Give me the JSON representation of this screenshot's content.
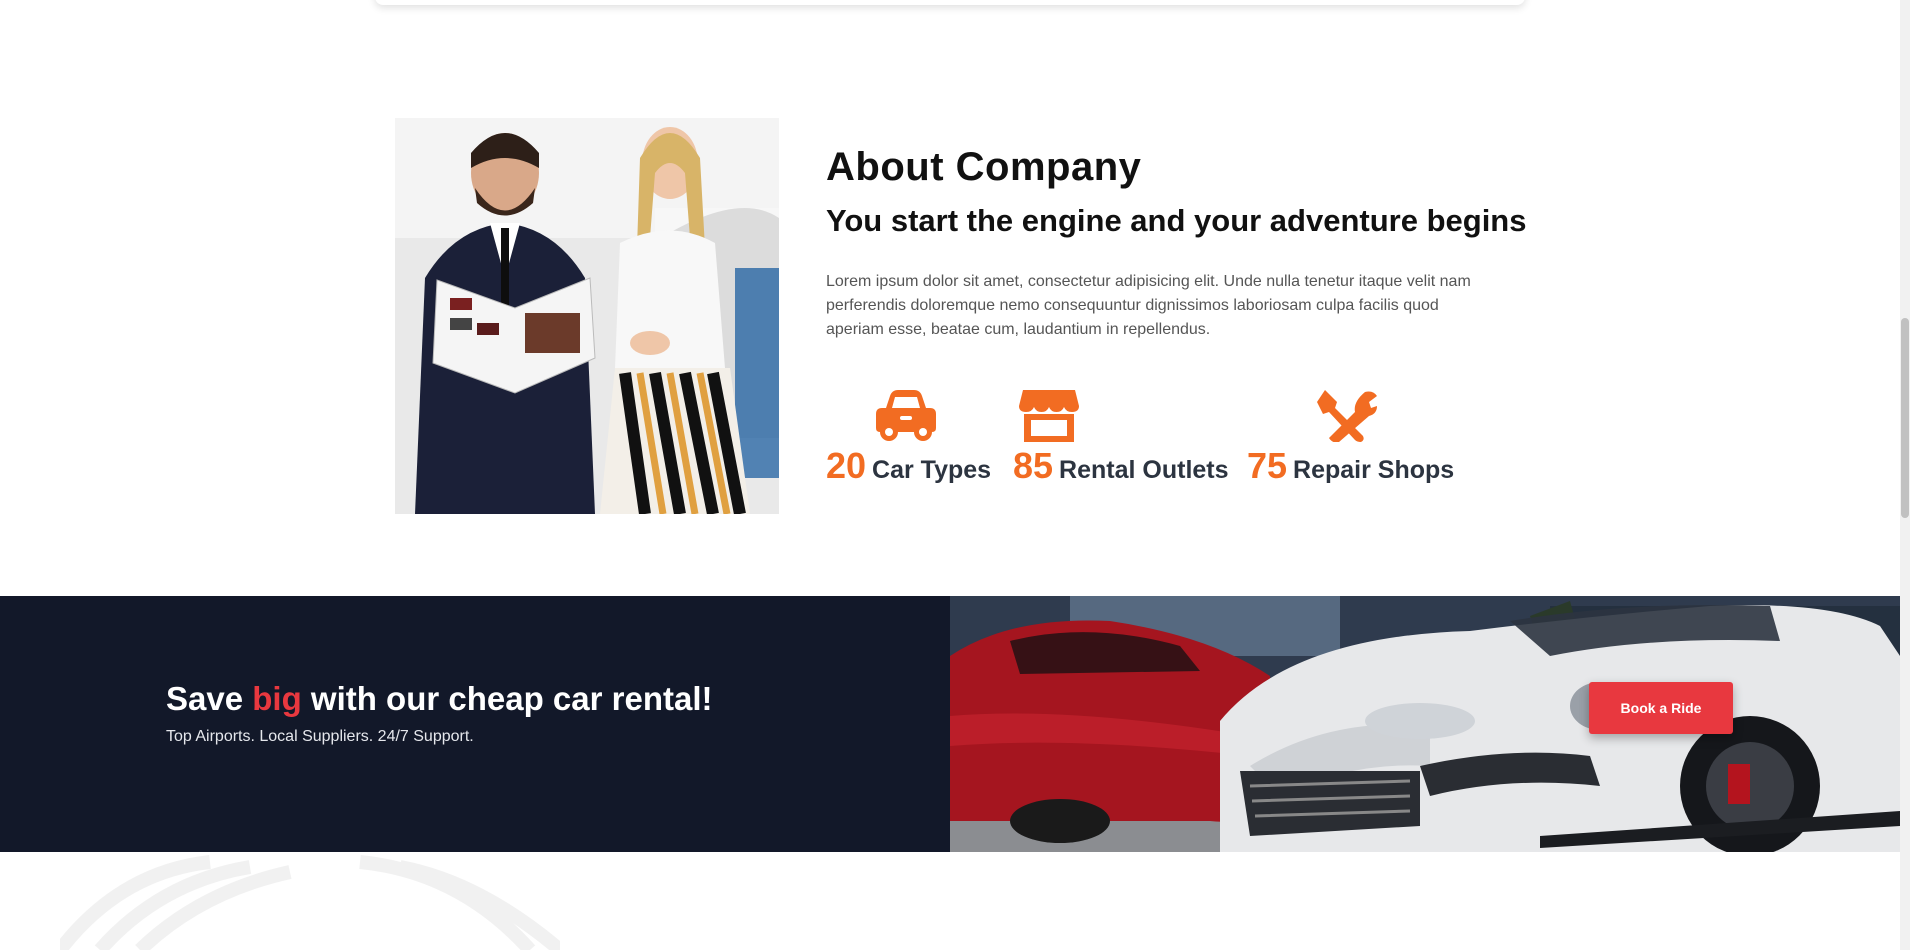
{
  "about": {
    "title": "About Company",
    "subtitle": "You start the engine and your adventure begins",
    "text": "Lorem ipsum dolor sit amet, consectetur adipisicing elit. Unde nulla tenetur itaque velit nam perferendis doloremque nemo consequuntur dignissimos laboriosam culpa facilis quod aperiam esse, beatae cum, laudantium in repellendus.",
    "stats": [
      {
        "number": "20",
        "label": "Car Types",
        "icon": "car-icon"
      },
      {
        "number": "85",
        "label": "Rental Outlets",
        "icon": "store-icon"
      },
      {
        "number": "75",
        "label": "Repair Shops",
        "icon": "tools-icon"
      }
    ]
  },
  "promo": {
    "title_before": "Save ",
    "title_accent": "big",
    "title_after": " with our cheap car rental!",
    "subtitle": "Top Airports. Local Suppliers. 24/7 Support.",
    "button_label": "Book a Ride"
  },
  "colors": {
    "accent_orange": "#f26c22",
    "accent_red": "#e8383f",
    "banner_bg": "#121829"
  }
}
